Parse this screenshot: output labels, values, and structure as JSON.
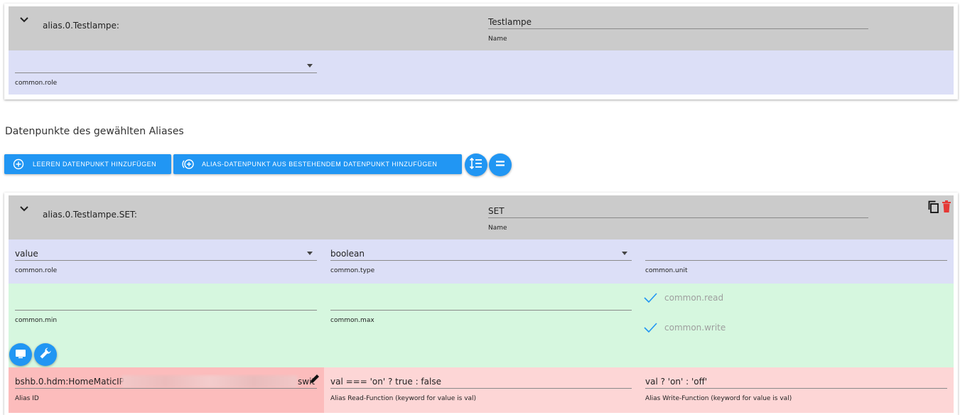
{
  "alias_card": {
    "id": "alias.0.Testlampe:",
    "name_value": "Testlampe",
    "name_label": "Name",
    "role_value": "",
    "role_label": "common.role"
  },
  "section": {
    "title": "Datenpunkte des gewählten Aliases"
  },
  "toolbar": {
    "add_empty_label": "LEEREN DATENPUNKT HINZUFÜGEN",
    "add_from_existing_label": "ALIAS-DATENPUNKT AUS BESTEHENDEM DATENPUNKT HINZUFÜGEN"
  },
  "datapoint": {
    "id": "alias.0.Testlampe.SET:",
    "name_value": "SET",
    "name_label": "Name",
    "role_value": "value",
    "role_label": "common.role",
    "type_value": "boolean",
    "type_label": "common.type",
    "unit_value": "",
    "unit_label": "common.unit",
    "min_value": "",
    "min_label": "common.min",
    "max_value": "",
    "max_label": "common.max",
    "read_label": "common.read",
    "write_label": "common.write",
    "alias_id_prefix": "bshb.0.hdm:HomeMaticIP",
    "alias_id_suffix": "swit",
    "alias_id_label": "Alias ID",
    "read_func_value": "val === 'on' ? true : false",
    "read_func_label": "Alias Read-Function (keyword for value is val)",
    "write_func_value": "val ? 'on' : 'off'",
    "write_func_label": "Alias Write-Function (keyword for value is val)"
  },
  "colors": {
    "accent": "#2196f3",
    "delete": "#e53935",
    "header_bg": "#cbcbcb",
    "row_blue": "#dcdff7",
    "row_green": "#d6f7df",
    "row_red": "#fdd6d6"
  },
  "icons": {
    "expand": "chevron-down-icon",
    "add_empty": "add-circle-icon",
    "add_existing": "add-circle-dashed-icon",
    "sort": "sort-lines-icon",
    "equal": "equal-icon",
    "copy": "copy-icon",
    "delete": "trash-icon",
    "edit": "edit-pencil-icon",
    "display": "display-icon",
    "wrench": "wrench-icon",
    "check": "check-icon"
  }
}
